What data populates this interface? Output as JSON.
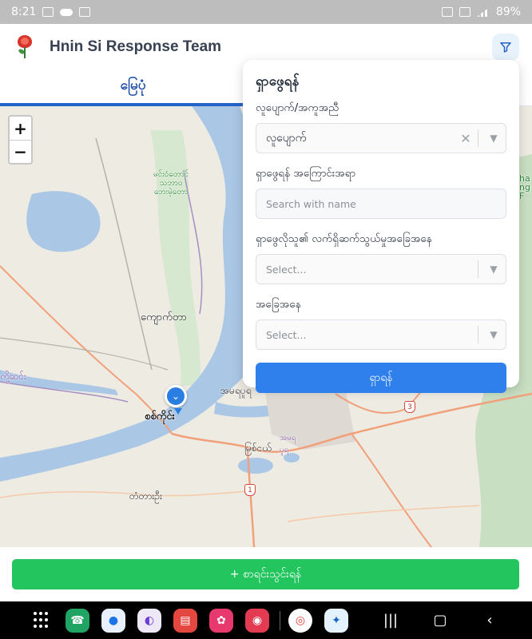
{
  "status_bar": {
    "time": "8:21",
    "battery": "89%"
  },
  "header": {
    "title": "Hnin Si Response Team"
  },
  "tabs": [
    {
      "label": "မြေပုံ",
      "active": true
    },
    {
      "label": "",
      "active": false
    }
  ],
  "map": {
    "zoom_in": "+",
    "zoom_out": "−",
    "labels": {
      "forest": "မင်းဝံတောင်\nသဘာဝ\nဘေးမဲ့တော",
      "kyaukphyu": "ကျောက်တာ",
      "sagaing": "စစ်ကိုင်း",
      "amarapura": "အမရပူရ",
      "myitnge": "မြစ်ငယ်",
      "amar2": "အမရ\nပူရ",
      "tadaoo": "တံတားဦး",
      "left_purple": "ကို့ဆင်း",
      "road_1": "1",
      "road_3": "3",
      "edge_text": "ha\nng\nF"
    }
  },
  "filter_panel": {
    "title": "ရှာဖွေရန်",
    "type_label": "လူပျောက်/အကူအညီ",
    "type_value": "လူပျောက်",
    "description_label": "ရှာဖွေရန် အကြောင်းအရာ",
    "search_placeholder": "Search with name",
    "contact_status_label": "ရှာဖွေလိုသူ၏ လက်ရှိဆက်သွယ်မှုအခြေအနေ",
    "contact_status_placeholder": "Select...",
    "status_label": "အခြေအနေ",
    "status_placeholder": "Select...",
    "search_button": "ရှာရန်"
  },
  "bottom": {
    "register_button": "+ စာရင်းသွင်းရန်"
  },
  "colors": {
    "primary": "#2f80ed",
    "tab_active": "#2563c9",
    "register": "#22c55e"
  }
}
